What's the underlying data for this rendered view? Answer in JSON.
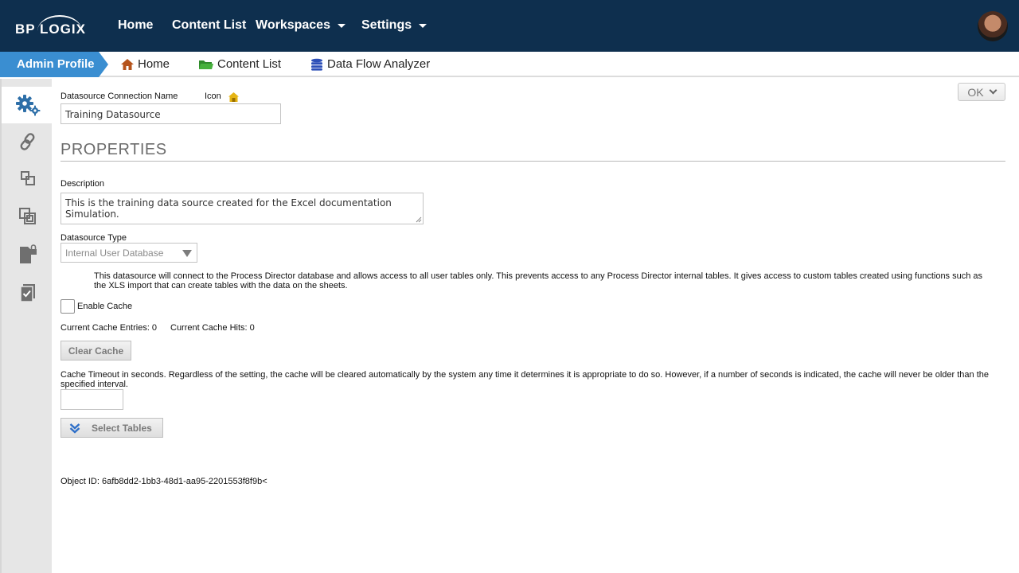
{
  "topnav": {
    "logo": "BP LOGIX",
    "items": [
      {
        "label": "Home"
      },
      {
        "label": "Content List"
      },
      {
        "label": "Workspaces"
      },
      {
        "label": "Settings"
      }
    ]
  },
  "breadcrumb": {
    "admin": "Admin Profile",
    "items": [
      {
        "label": "Home",
        "icon": "home-icon"
      },
      {
        "label": "Content List",
        "icon": "folder-icon"
      },
      {
        "label": "Data Flow Analyzer",
        "icon": "database-icon"
      }
    ]
  },
  "rail": {
    "icons": [
      "gears-icon",
      "link-icon",
      "objects-icon",
      "copy-icon",
      "locked-file-icon",
      "checklist-icon"
    ]
  },
  "form": {
    "conn_name_label": "Datasource Connection Name",
    "icon_label": "Icon",
    "conn_name_value": "Training Datasource",
    "properties_title": "PROPERTIES",
    "description_label": "Description",
    "description_value": "This is the training data source created for the Excel documentation Simulation.",
    "type_label": "Datasource Type",
    "type_value": "Internal User Database",
    "type_info": "This datasource will connect to the Process Director database and allows access to all user tables only. This prevents access to any Process Director internal tables. It gives access to custom tables created using functions such as the XLS import that can create tables with the data on the sheets.",
    "enable_cache_label": "Enable Cache",
    "cache_entries": "Current Cache Entries: 0",
    "cache_hits": "Current Cache Hits: 0",
    "clear_cache_label": "Clear Cache",
    "cache_timeout_label": "Cache Timeout in seconds. Regardless of the setting, the cache will be cleared automatically by the system any time it determines it is appropriate to do so. However, if a number of seconds is indicated, the cache will never be older than the specified interval.",
    "cache_timeout_value": "",
    "select_tables_label": "Select Tables",
    "object_id": "Object ID: 6afb8dd2-1bb3-48d1-aa95-2201553f8f9b<",
    "ok_label": "OK"
  },
  "colors": {
    "topbar": "#0e2f4e",
    "accent": "#3a8ed1",
    "rail": "#e6e6e6"
  }
}
